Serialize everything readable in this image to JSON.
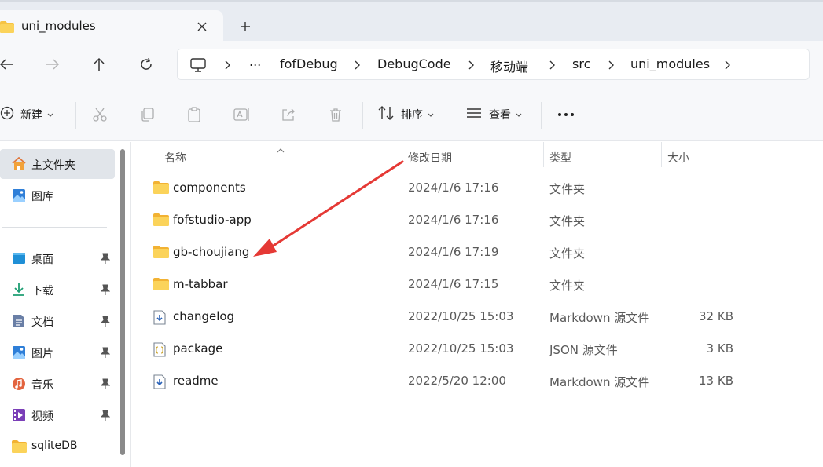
{
  "tab": {
    "title": "uni_modules"
  },
  "breadcrumb": [
    "...",
    "fofDebug",
    "DebugCode",
    "移动端",
    "src",
    "uni_modules"
  ],
  "commands": {
    "new_label": "新建",
    "sort_label": "排序",
    "view_label": "查看"
  },
  "sidebar": {
    "items": [
      {
        "label": "主文件夹",
        "icon": "home-icon",
        "pinned": false,
        "selected": true
      },
      {
        "label": "图库",
        "icon": "gallery-icon",
        "pinned": false
      },
      {
        "label": "桌面",
        "icon": "desktop-icon",
        "pinned": true
      },
      {
        "label": "下载",
        "icon": "download-icon",
        "pinned": true
      },
      {
        "label": "文档",
        "icon": "documents-icon",
        "pinned": true
      },
      {
        "label": "图片",
        "icon": "pictures-icon",
        "pinned": true
      },
      {
        "label": "音乐",
        "icon": "music-icon",
        "pinned": true
      },
      {
        "label": "视频",
        "icon": "video-icon",
        "pinned": true
      },
      {
        "label": "sqliteDB",
        "icon": "folder-icon",
        "pinned": false
      }
    ]
  },
  "columns": {
    "name": "名称",
    "modified": "修改日期",
    "type": "类型",
    "size": "大小"
  },
  "files": [
    {
      "name": "components",
      "date": "2024/1/6 17:16",
      "type": "文件夹",
      "size": "",
      "icon": "folder-icon"
    },
    {
      "name": "fofstudio-app",
      "date": "2024/1/6 17:16",
      "type": "文件夹",
      "size": "",
      "icon": "folder-icon"
    },
    {
      "name": "gb-choujiang",
      "date": "2024/1/6 17:19",
      "type": "文件夹",
      "size": "",
      "icon": "folder-icon"
    },
    {
      "name": "m-tabbar",
      "date": "2024/1/6 17:15",
      "type": "文件夹",
      "size": "",
      "icon": "folder-icon"
    },
    {
      "name": "changelog",
      "date": "2022/10/25 15:03",
      "type": "Markdown 源文件",
      "size": "32 KB",
      "icon": "markdown-file-icon"
    },
    {
      "name": "package",
      "date": "2022/10/25 15:03",
      "type": "JSON 源文件",
      "size": "3 KB",
      "icon": "json-file-icon"
    },
    {
      "name": "readme",
      "date": "2022/5/20 12:00",
      "type": "Markdown 源文件",
      "size": "13 KB",
      "icon": "markdown-file-icon"
    }
  ],
  "colors": {
    "folder": "#f6c343",
    "annotation_arrow": "#e53935",
    "selection": "#e1e5ea"
  }
}
